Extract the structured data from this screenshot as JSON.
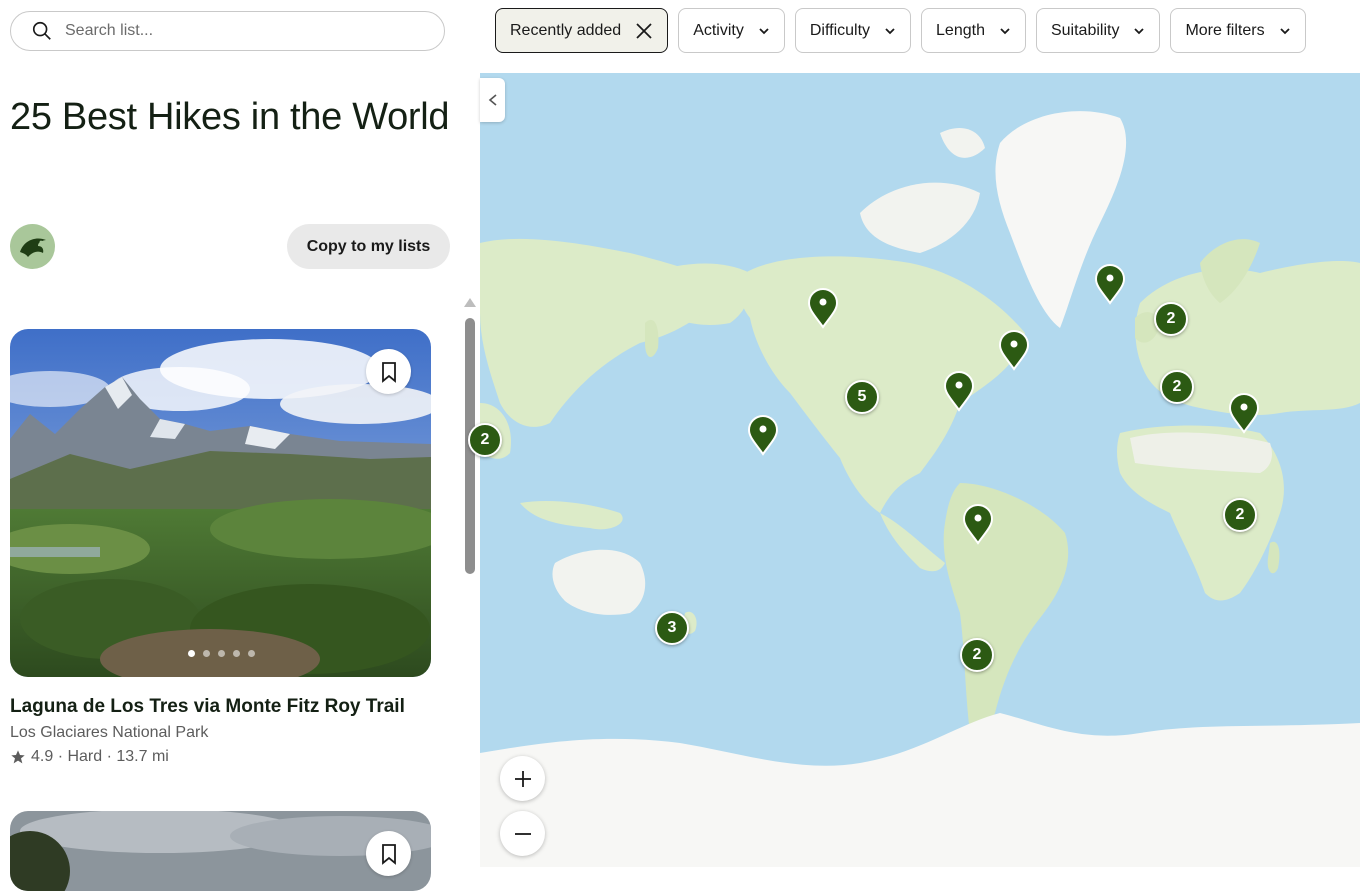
{
  "search": {
    "placeholder": "Search list..."
  },
  "filters": {
    "active": {
      "label": "Recently added"
    },
    "chips": [
      {
        "label": "Activity"
      },
      {
        "label": "Difficulty"
      },
      {
        "label": "Length"
      },
      {
        "label": "Suitability"
      },
      {
        "label": "More filters"
      }
    ]
  },
  "list": {
    "title": "25 Best Hikes in the World",
    "copy_label": "Copy to my lists"
  },
  "card": {
    "title": "Laguna de Los Tres via Monte Fitz Roy Trail",
    "park": "Los Glaciares National Park",
    "meta": "4.9 · Hard · 13.7 mi",
    "photo_count": 5,
    "active_photo": 1
  },
  "map": {
    "clusters": [
      {
        "count": "2",
        "name": "map-cluster-east-asia"
      },
      {
        "count": "5",
        "name": "map-cluster-west-north-america"
      },
      {
        "count": "2",
        "name": "map-cluster-northern-europe"
      },
      {
        "count": "2",
        "name": "map-cluster-central-europe"
      },
      {
        "count": "2",
        "name": "map-cluster-east-africa"
      },
      {
        "count": "3",
        "name": "map-cluster-new-zealand"
      },
      {
        "count": "2",
        "name": "map-cluster-patagonia"
      }
    ]
  },
  "colors": {
    "accent": "#2c5a13",
    "water": "#b2d9ee",
    "land": "#dcebc8",
    "ice": "#f7f7f5"
  }
}
